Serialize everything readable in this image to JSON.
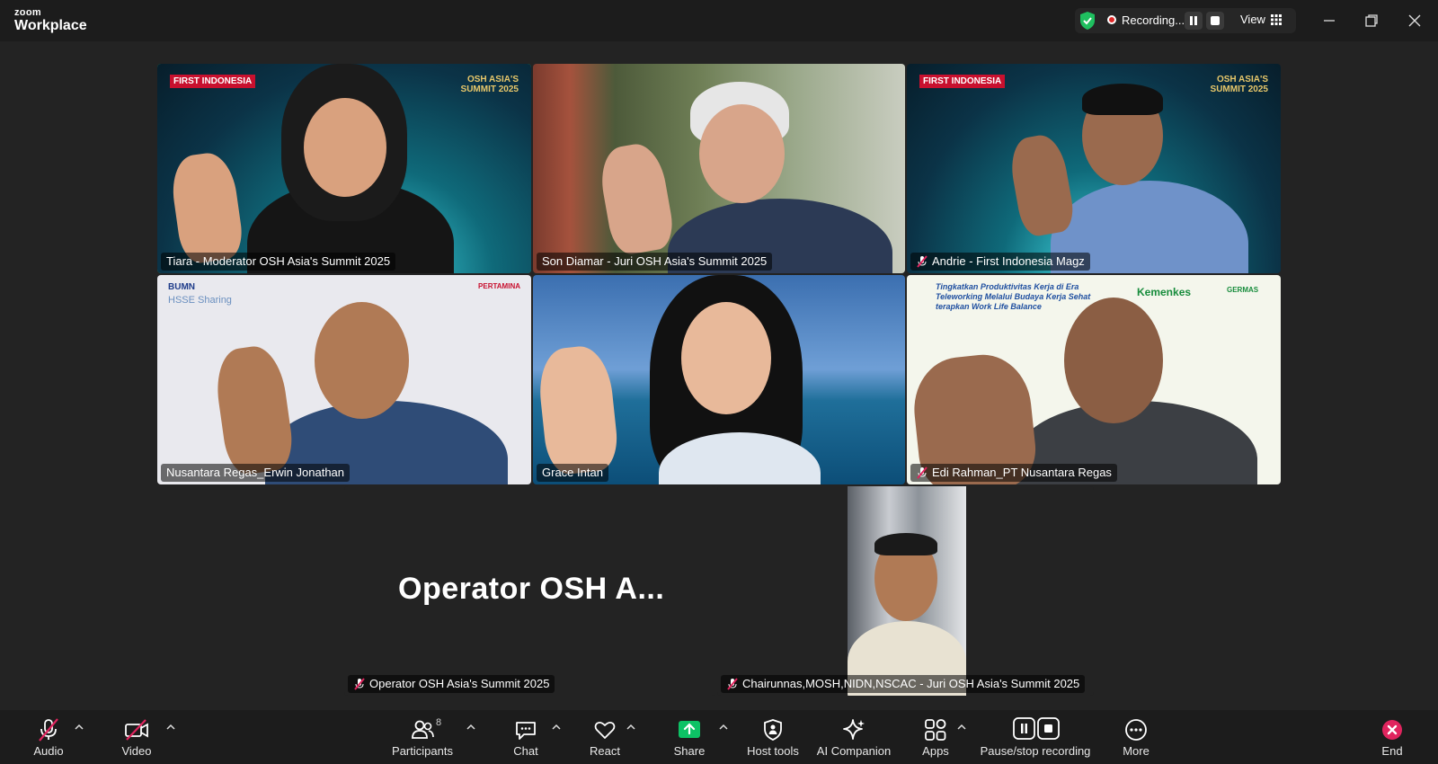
{
  "app": {
    "logo_line1": "zoom",
    "logo_line2": "Workplace",
    "recording_label": "Recording...",
    "view_label": "View"
  },
  "tiles": [
    {
      "name": "Tiara - Moderator OSH Asia's Summit 2025",
      "muted": false,
      "active": true
    },
    {
      "name": "Son Diamar - Juri OSH Asia's Summit 2025",
      "muted": false,
      "active": false
    },
    {
      "name": "Andrie - First Indonesia Magz",
      "muted": true,
      "active": false
    },
    {
      "name": "Nusantara Regas_Erwin Jonathan",
      "muted": false,
      "active": false
    },
    {
      "name": "Grace Intan",
      "muted": false,
      "active": false
    },
    {
      "name": "Edi Rahman_PT Nusantara Regas",
      "muted": true,
      "active": false
    },
    {
      "name": "Operator OSH Asia's Summit 2025",
      "muted": true,
      "active": false,
      "placeholder_text": "Operator OSH A..."
    },
    {
      "name": "Chairunnas,MOSH,NIDN,NSCAC - Juri OSH Asia's Summit 2025",
      "muted": true,
      "active": false
    }
  ],
  "backgrounds": {
    "first_indonesia": "FIRST INDONESIA",
    "osh_summit": "OSH ASIA'S SUMMIT 2025",
    "hsse_sharing": "HSSE Sharing",
    "bumn": "BUMN",
    "pertamina": "PERTAMINA",
    "kemenkes": "Kemenkes",
    "webinar_title": "Tingkatkan Produktivitas Kerja di Era Teleworking Melalui Budaya Kerja Sehat terapkan Work Life Balance",
    "germas": "GERMAS"
  },
  "toolbar": {
    "audio": "Audio",
    "video": "Video",
    "participants": "Participants",
    "participants_count": "8",
    "chat": "Chat",
    "react": "React",
    "share": "Share",
    "host_tools": "Host tools",
    "ai_companion": "AI Companion",
    "apps": "Apps",
    "pause_stop": "Pause/stop recording",
    "more": "More",
    "end": "End"
  },
  "colors": {
    "active_border": "#2fd67a",
    "recording_red": "#e02828",
    "share_green": "#0dc265",
    "end_red": "#e0245e",
    "mute_red": "#e0245e"
  }
}
